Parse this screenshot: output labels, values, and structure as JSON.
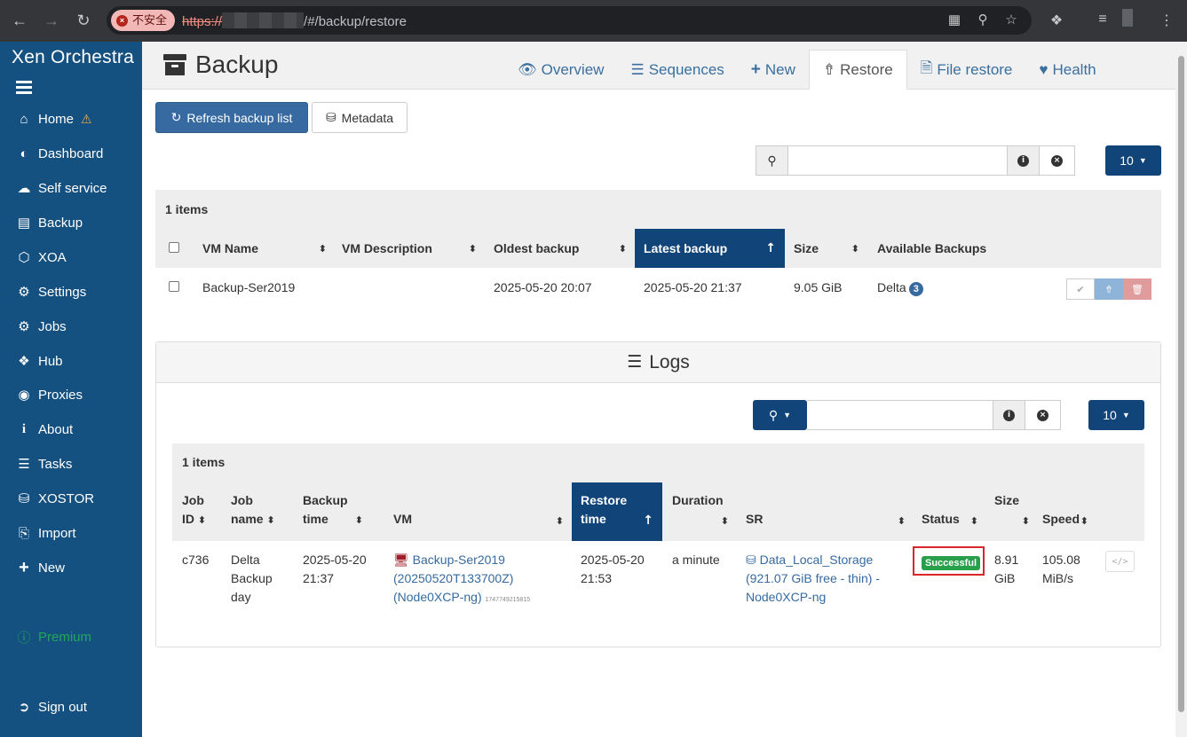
{
  "browser": {
    "insecure_label": "不安全",
    "url_proto": "https://",
    "url_path": "/#/backup/restore"
  },
  "sidebar": {
    "brand": "Xen Orchestra",
    "items": [
      {
        "label": "Home",
        "icon": "home-icon"
      },
      {
        "label": "Dashboard",
        "icon": "dashboard-icon"
      },
      {
        "label": "Self service",
        "icon": "cloud-icon"
      },
      {
        "label": "Backup",
        "icon": "archive-icon"
      },
      {
        "label": "XOA",
        "icon": "cube-icon"
      },
      {
        "label": "Settings",
        "icon": "cog-icon"
      },
      {
        "label": "Jobs",
        "icon": "cogs-icon"
      },
      {
        "label": "Hub",
        "icon": "cubes-icon"
      },
      {
        "label": "Proxies",
        "icon": "globe-icon"
      },
      {
        "label": "About",
        "icon": "info-icon"
      },
      {
        "label": "Tasks",
        "icon": "tasks-icon"
      },
      {
        "label": "XOSTOR",
        "icon": "database-icon"
      },
      {
        "label": "Import",
        "icon": "import-icon"
      },
      {
        "label": "New",
        "icon": "plus-icon"
      }
    ],
    "premium": "Premium",
    "signout": "Sign out"
  },
  "header": {
    "title": "Backup",
    "tabs": [
      {
        "label": "Overview",
        "icon": "eye-icon"
      },
      {
        "label": "Sequences",
        "icon": "list-icon"
      },
      {
        "label": "New",
        "icon": "plus-icon"
      },
      {
        "label": "Restore",
        "icon": "upload-icon",
        "active": true
      },
      {
        "label": "File restore",
        "icon": "file-icon"
      },
      {
        "label": "Health",
        "icon": "heartbeat-icon"
      }
    ]
  },
  "toolbar": {
    "refresh_label": "Refresh backup list",
    "metadata_label": "Metadata"
  },
  "backups_table": {
    "page_size": "10",
    "count": "1 items",
    "columns": [
      "VM Name",
      "VM Description",
      "Oldest backup",
      "Latest backup",
      "Size",
      "Available Backups"
    ],
    "rows": [
      {
        "vm_name": "Backup-Ser2019",
        "vm_description": "",
        "oldest": "2025-05-20 20:07",
        "latest": "2025-05-20 21:37",
        "size": "9.05 GiB",
        "available": "Delta",
        "available_count": "3"
      }
    ]
  },
  "logs": {
    "title": "Logs",
    "page_size": "10",
    "count": "1 items",
    "columns": {
      "job_id": [
        "Job",
        "ID"
      ],
      "job_name": [
        "Job",
        "name"
      ],
      "backup_time": [
        "Backup",
        "time"
      ],
      "vm": "VM",
      "restore_time": [
        "Restore",
        "time"
      ],
      "duration": "Duration",
      "sr": "SR",
      "status": "Status",
      "size": "Size",
      "speed": "Speed"
    },
    "rows": [
      {
        "job_id": "c736",
        "job_name": [
          "Delta",
          "Backup",
          "day"
        ],
        "backup_time": [
          "2025-05-20",
          "21:37"
        ],
        "vm": [
          "Backup-Ser2019",
          "(20250520T133700Z)",
          "(Node0XCP-ng)"
        ],
        "vm_small": "1747749215815",
        "restore_time": [
          "2025-05-20",
          "21:53"
        ],
        "duration": "a minute",
        "sr": [
          "Data_Local_Storage",
          "(921.07 GiB free - thin) -",
          "Node0XCP-ng"
        ],
        "status": "Successful",
        "size": [
          "8.91",
          "GiB"
        ],
        "speed": [
          "105.08",
          "MiB/s"
        ]
      }
    ]
  },
  "colors": {
    "sidebar": "#145080",
    "accent": "#11457a",
    "link": "#366aa0",
    "success": "#27a049",
    "highlight": "#d9262a"
  }
}
